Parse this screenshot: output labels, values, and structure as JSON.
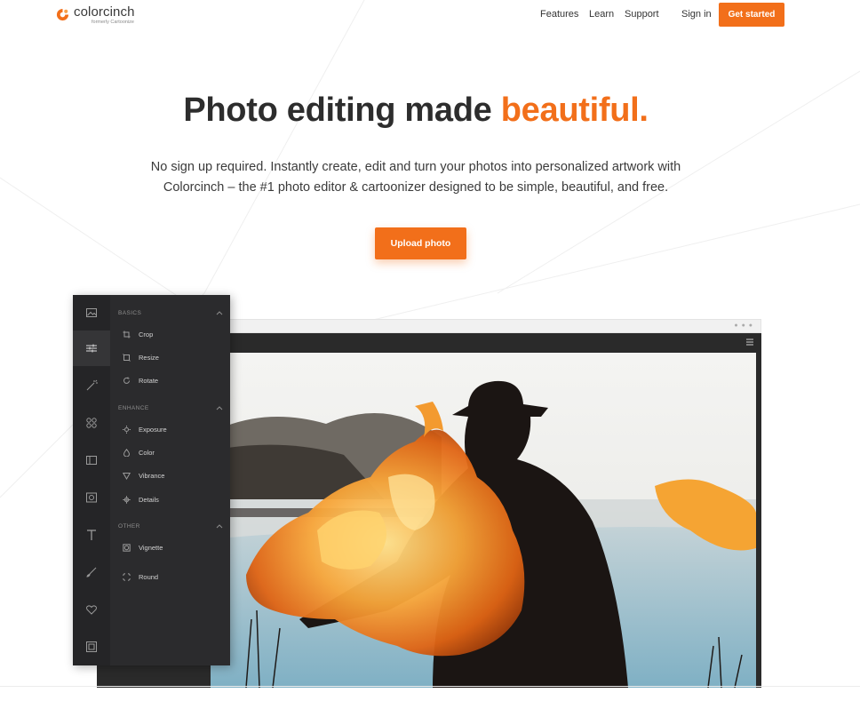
{
  "brand": {
    "name": "colorcinch",
    "subtitle": "formerly Cartoonize",
    "accent_color": "#f26f1a"
  },
  "nav": {
    "features": "Features",
    "learn": "Learn",
    "support": "Support",
    "sign_in": "Sign in",
    "get_started": "Get started"
  },
  "hero": {
    "title_main": "Photo editing made ",
    "title_accent": "beautiful.",
    "description": "No sign up required. Instantly create, edit and turn your photos into personalized artwork with Colorcinch – the #1 photo editor & cartoonizer designed to be simple, beautiful, and free.",
    "upload_button": "Upload photo"
  },
  "editor": {
    "rail_icons": [
      "image-icon",
      "sliders-icon",
      "magic-wand-icon",
      "grid-icon",
      "layout-icon",
      "camera-icon",
      "text-icon",
      "brush-icon",
      "heart-icon",
      "frame-icon"
    ],
    "sections": [
      {
        "title": "BASICS",
        "items": [
          {
            "label": "Crop",
            "icon": "crop-icon"
          },
          {
            "label": "Resize",
            "icon": "resize-icon"
          },
          {
            "label": "Rotate",
            "icon": "rotate-icon"
          }
        ]
      },
      {
        "title": "ENHANCE",
        "items": [
          {
            "label": "Exposure",
            "icon": "exposure-icon"
          },
          {
            "label": "Color",
            "icon": "color-icon"
          },
          {
            "label": "Vibrance",
            "icon": "vibrance-icon"
          },
          {
            "label": "Details",
            "icon": "details-icon"
          }
        ]
      },
      {
        "title": "OTHER",
        "items": [
          {
            "label": "Vignette",
            "icon": "vignette-icon"
          },
          {
            "label": "Round",
            "icon": "round-icon"
          }
        ]
      }
    ]
  }
}
